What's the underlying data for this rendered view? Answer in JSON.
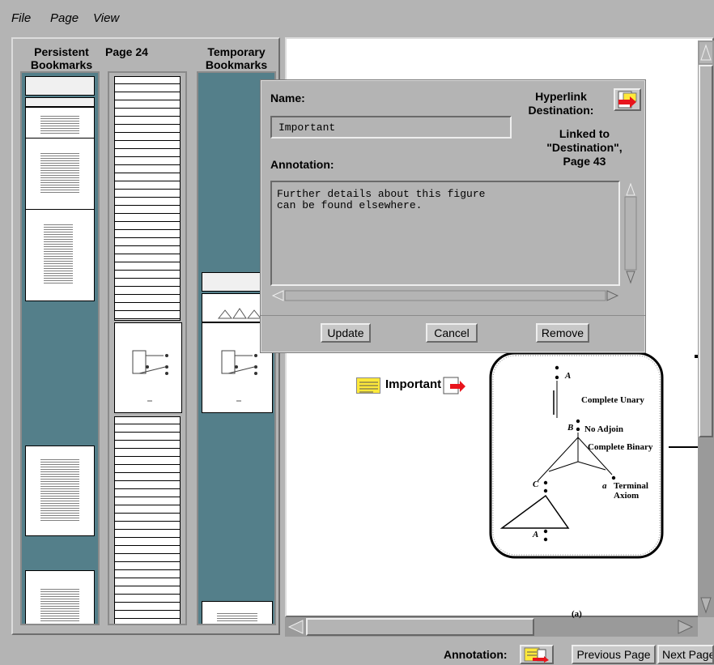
{
  "menu": {
    "file": "File",
    "page": "Page",
    "view": "View"
  },
  "columns": {
    "persistent": "Persistent\nBookmarks",
    "page": "Page 24",
    "temporary": "Temporary\nBookmarks"
  },
  "dialog": {
    "name_label": "Name:",
    "name_value": "Important",
    "hyperlink_label": "Hyperlink\nDestination:",
    "linked_text": "Linked to\n\"Destination\",\nPage 43",
    "annotation_label": "Annotation:",
    "annotation_text": "Further details about this figure\ncan be found elsewhere.",
    "buttons": {
      "update": "Update",
      "cancel": "Cancel",
      "remove": "Remove"
    }
  },
  "document": {
    "bookmark_label": "Important",
    "figure": {
      "labels": [
        "A",
        "Complete Unary",
        "B",
        "No Adjoin",
        "Complete Binary",
        "C",
        "a",
        "Terminal\nAxiom",
        "A",
        "(a)"
      ]
    }
  },
  "bottom_bar": {
    "annotation_label": "Annotation:",
    "previous_page": "Previous Page",
    "next_page": "Next Page"
  },
  "icons": [
    "link-icon",
    "annotation-icon",
    "arrow-left-icon",
    "arrow-right-icon",
    "arrow-up-icon",
    "arrow-down-icon"
  ]
}
